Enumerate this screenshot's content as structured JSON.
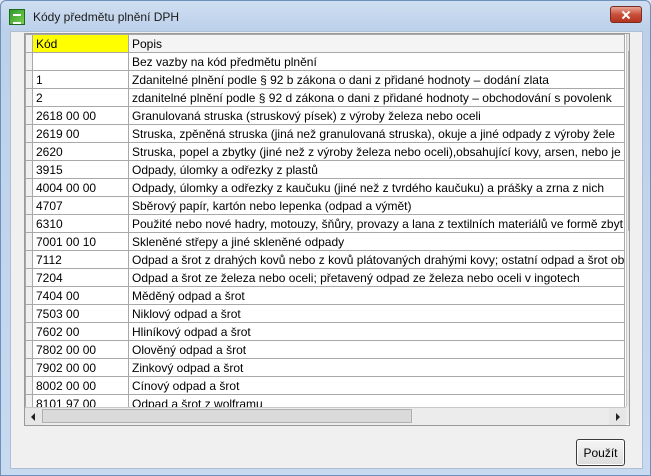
{
  "window": {
    "title": "Kódy předmětu plnění DPH",
    "app_icon": "green-dph-app-icon",
    "close_icon": "close-x-icon"
  },
  "table": {
    "columns": [
      "Kód",
      "Popis"
    ],
    "rows": [
      {
        "code": "",
        "desc": "Bez vazby na  kód předmětu plnění"
      },
      {
        "code": "1",
        "desc": "Zdanitelné plnění podle § 92 b zákona o dani z přidané hodnoty – dodání zlata"
      },
      {
        "code": "2",
        "desc": "zdanitelné plnění podle § 92 d zákona o dani z přidané hodnoty – obchodování s povolenk"
      },
      {
        "code": "2618 00 00",
        "desc": "Granulovaná struska (struskový písek) z výroby železa nebo oceli"
      },
      {
        "code": "2619 00",
        "desc": "Struska, zpěněná struska (jiná než granulovaná struska), okuje a jiné odpady z výroby žele"
      },
      {
        "code": "2620",
        "desc": "Struska, popel a zbytky (jiné než z výroby železa nebo oceli),obsahující kovy, arsen, nebo je"
      },
      {
        "code": "3915",
        "desc": "Odpady, úlomky a odřezky z plastů"
      },
      {
        "code": "4004 00 00",
        "desc": "Odpady, úlomky a odřezky z kaučuku (jiné než z tvrdého kaučuku) a prášky a zrna z nich"
      },
      {
        "code": "4707",
        "desc": "Sběrový papír, kartón nebo lepenka (odpad a výmět)"
      },
      {
        "code": "6310",
        "desc": "Použité nebo nové hadry, motouzy, šňůry, provazy a lana z textilních materiálů ve formě zbyt"
      },
      {
        "code": "7001 00 10",
        "desc": "Skleněné střepy a jiné skleněné odpady"
      },
      {
        "code": "7112",
        "desc": "Odpad a šrot z drahých kovů nebo z kovů plátovaných drahými kovy; ostatní odpad a šrot ob"
      },
      {
        "code": "7204",
        "desc": "Odpad a šrot ze železa nebo oceli; přetavený odpad ze železa nebo oceli v ingotech"
      },
      {
        "code": "7404 00",
        "desc": "Měděný odpad a šrot"
      },
      {
        "code": "7503 00",
        "desc": "Niklový odpad a šrot"
      },
      {
        "code": "7602 00",
        "desc": "Hliníkový odpad a šrot"
      },
      {
        "code": "7802 00 00",
        "desc": "Olověný odpad a šrot"
      },
      {
        "code": "7902 00 00",
        "desc": "Zinkový odpad a šrot"
      },
      {
        "code": "8002 00 00",
        "desc": "Cínový odpad a šrot"
      },
      {
        "code": "8101 97 00",
        "desc": "Odpad a šrot z wolframu"
      }
    ]
  },
  "scrollbars": {
    "up_icon": "scroll-up-arrow-icon",
    "down_icon": "scroll-down-arrow-icon",
    "left_icon": "scroll-left-arrow-icon",
    "right_icon": "scroll-right-arrow-icon"
  },
  "footer": {
    "ok_label": "Použít"
  }
}
